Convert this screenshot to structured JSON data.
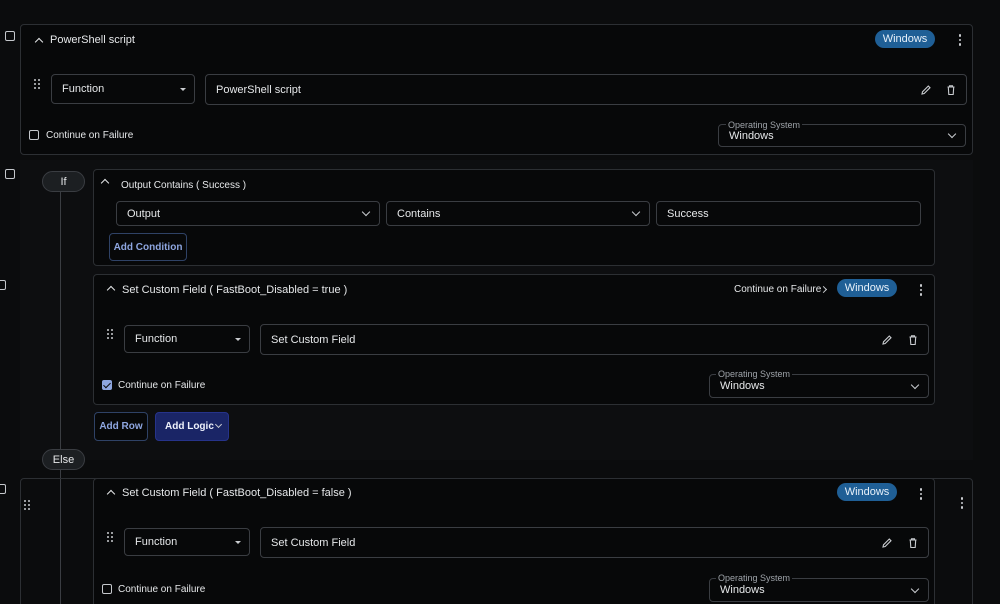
{
  "step1": {
    "title": "PowerShell script",
    "os_badge": "Windows",
    "row_type": "Function",
    "row_value": "PowerShell script",
    "continue_on_failure": "Continue on Failure",
    "continue_checked": false,
    "os_field_label": "Operating System",
    "os_value": "Windows"
  },
  "if_block": {
    "if_label": "If",
    "condition_title": "Output Contains ( Success )",
    "condition_field": "Output",
    "condition_operator": "Contains",
    "condition_value": "Success",
    "add_condition": "Add Condition",
    "action": {
      "title": "Set Custom Field ( FastBoot_Disabled = true )",
      "continue_link": "Continue on Failure",
      "os_badge": "Windows",
      "row_type": "Function",
      "row_value": "Set Custom Field",
      "continue_on_failure": "Continue on Failure",
      "continue_checked": true,
      "os_field_label": "Operating System",
      "os_value": "Windows"
    },
    "add_row": "Add Row",
    "add_logic": "Add Logic"
  },
  "else_block": {
    "else_label": "Else",
    "action": {
      "title": "Set Custom Field ( FastBoot_Disabled = false )",
      "os_badge": "Windows",
      "row_type": "Function",
      "row_value": "Set Custom Field",
      "continue_on_failure": "Continue on Failure",
      "continue_checked": false,
      "os_field_label": "Operating System",
      "os_value": "Windows"
    }
  },
  "icons": [
    "checkbox-icon",
    "chevron-up-icon",
    "chevron-down-icon",
    "chevron-right-icon",
    "drag-handle-icon",
    "kebab-menu-icon",
    "pencil-icon",
    "trash-icon"
  ],
  "colors": {
    "background": "#0b0c0d",
    "badge": "#1f5f96",
    "accent_outline": "#8ea6e0",
    "add_logic": "#1a2566"
  }
}
